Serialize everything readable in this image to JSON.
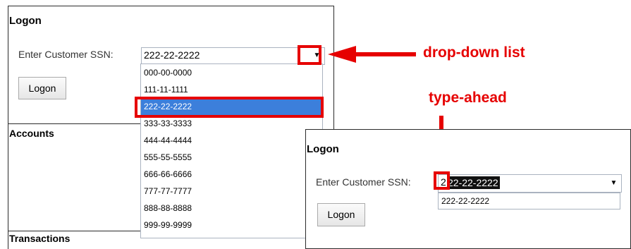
{
  "left": {
    "title": "Logon",
    "ssn_label": "Enter Customer SSN:",
    "ssn_value": "222-22-2222",
    "logon_button": "Logon",
    "accounts": "Accounts",
    "transactions": "Transactions"
  },
  "dropdown": {
    "options": [
      "000-00-0000",
      "111-11-1111",
      "222-22-2222",
      "333-33-3333",
      "444-44-4444",
      "555-55-5555",
      "666-66-6666",
      "777-77-7777",
      "888-88-8888",
      "999-99-9999"
    ],
    "selected_index": 2
  },
  "annotations": {
    "dropdown_label": "drop-down list",
    "typeahead_label": "type-ahead"
  },
  "right": {
    "title": "Logon",
    "ssn_label": "Enter Customer SSN:",
    "typed_char": "2",
    "autocomplete_rest": "22-22-2222",
    "suggestion": "222-22-2222",
    "logon_button": "Logon"
  },
  "icons": {
    "dropdown_arrow": "caret-down-icon"
  },
  "colors": {
    "accent_red": "#e60000",
    "selection_blue": "#3c7fdb"
  }
}
